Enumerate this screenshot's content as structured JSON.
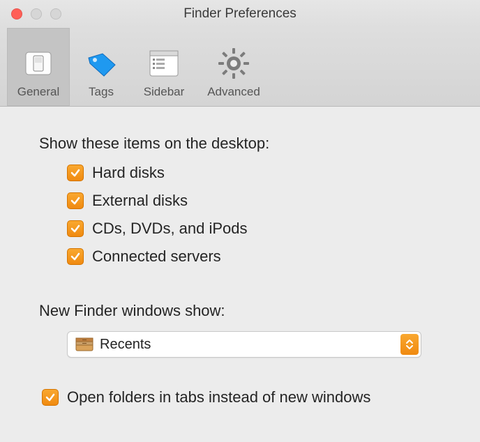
{
  "window": {
    "title": "Finder Preferences"
  },
  "tabs": [
    {
      "label": "General"
    },
    {
      "label": "Tags"
    },
    {
      "label": "Sidebar"
    },
    {
      "label": "Advanced"
    }
  ],
  "section_desktop": {
    "heading": "Show these items on the desktop:",
    "items": [
      {
        "label": "Hard disks"
      },
      {
        "label": "External disks"
      },
      {
        "label": "CDs, DVDs, and iPods"
      },
      {
        "label": "Connected servers"
      }
    ]
  },
  "section_newwin": {
    "heading": "New Finder windows show:",
    "selected": "Recents"
  },
  "open_in_tabs": {
    "label": "Open folders in tabs instead of new windows"
  },
  "colors": {
    "accent": "#f29514"
  }
}
